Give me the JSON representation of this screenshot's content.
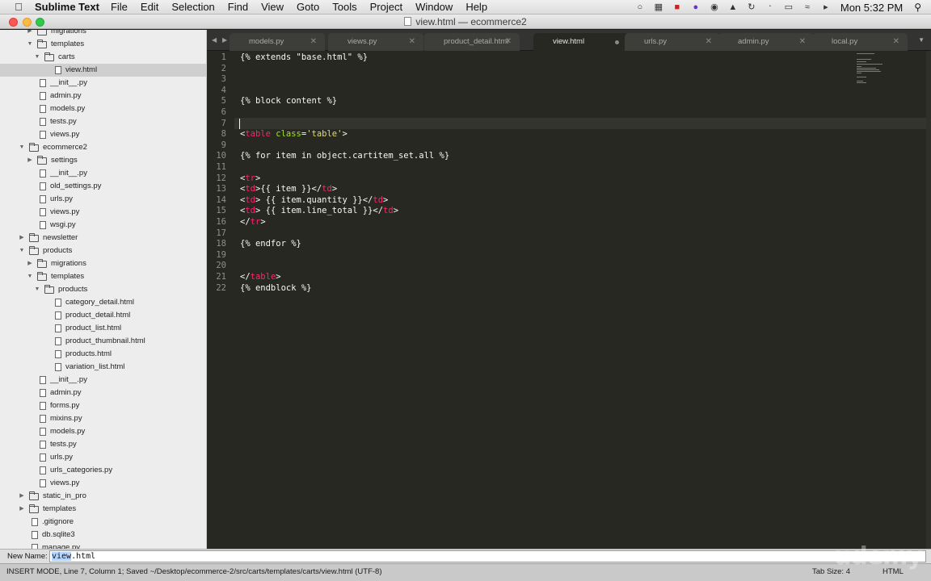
{
  "menubar": {
    "app_name": "Sublime Text",
    "items": [
      "File",
      "Edit",
      "Selection",
      "Find",
      "View",
      "Goto",
      "Tools",
      "Project",
      "Window",
      "Help"
    ],
    "clock": "Mon 5:32 PM",
    "status_icons": [
      "dropbox-icon",
      "menu-tool-icon",
      "evernote-icon",
      "cloud-app-icon",
      "privacy-icon",
      "notification-icon",
      "time-machine-icon",
      "bluetooth-icon",
      "battery-icon",
      "wifi-icon",
      "volume-icon"
    ]
  },
  "window": {
    "title": "view.html — ecommerce2"
  },
  "sidebar": {
    "rows": [
      {
        "name": "migrations",
        "type": "folder",
        "depth": 2,
        "expanded": false
      },
      {
        "name": "templates",
        "type": "folder",
        "depth": 2,
        "expanded": true
      },
      {
        "name": "carts",
        "type": "folder",
        "depth": 3,
        "expanded": true
      },
      {
        "name": "view.html",
        "type": "file",
        "depth": 4,
        "selected": true
      },
      {
        "name": "__init__.py",
        "type": "file",
        "depth": 2
      },
      {
        "name": "admin.py",
        "type": "file",
        "depth": 2
      },
      {
        "name": "models.py",
        "type": "file",
        "depth": 2
      },
      {
        "name": "tests.py",
        "type": "file",
        "depth": 2
      },
      {
        "name": "views.py",
        "type": "file",
        "depth": 2
      },
      {
        "name": "ecommerce2",
        "type": "folder",
        "depth": 1,
        "expanded": true
      },
      {
        "name": "settings",
        "type": "folder",
        "depth": 2,
        "expanded": false
      },
      {
        "name": "__init__.py",
        "type": "file",
        "depth": 2
      },
      {
        "name": "old_settings.py",
        "type": "file",
        "depth": 2
      },
      {
        "name": "urls.py",
        "type": "file",
        "depth": 2
      },
      {
        "name": "views.py",
        "type": "file",
        "depth": 2
      },
      {
        "name": "wsgi.py",
        "type": "file",
        "depth": 2
      },
      {
        "name": "newsletter",
        "type": "folder",
        "depth": 1,
        "expanded": false
      },
      {
        "name": "products",
        "type": "folder",
        "depth": 1,
        "expanded": true
      },
      {
        "name": "migrations",
        "type": "folder",
        "depth": 2,
        "expanded": false
      },
      {
        "name": "templates",
        "type": "folder",
        "depth": 2,
        "expanded": true
      },
      {
        "name": "products",
        "type": "folder",
        "depth": 3,
        "expanded": true
      },
      {
        "name": "category_detail.html",
        "type": "file",
        "depth": 4
      },
      {
        "name": "product_detail.html",
        "type": "file",
        "depth": 4
      },
      {
        "name": "product_list.html",
        "type": "file",
        "depth": 4
      },
      {
        "name": "product_thumbnail.html",
        "type": "file",
        "depth": 4
      },
      {
        "name": "products.html",
        "type": "file",
        "depth": 4
      },
      {
        "name": "variation_list.html",
        "type": "file",
        "depth": 4
      },
      {
        "name": "__init__.py",
        "type": "file",
        "depth": 2
      },
      {
        "name": "admin.py",
        "type": "file",
        "depth": 2
      },
      {
        "name": "forms.py",
        "type": "file",
        "depth": 2
      },
      {
        "name": "mixins.py",
        "type": "file",
        "depth": 2
      },
      {
        "name": "models.py",
        "type": "file",
        "depth": 2
      },
      {
        "name": "tests.py",
        "type": "file",
        "depth": 2
      },
      {
        "name": "urls.py",
        "type": "file",
        "depth": 2
      },
      {
        "name": "urls_categories.py",
        "type": "file",
        "depth": 2
      },
      {
        "name": "views.py",
        "type": "file",
        "depth": 2
      },
      {
        "name": "static_in_pro",
        "type": "folder",
        "depth": 1,
        "expanded": false
      },
      {
        "name": "templates",
        "type": "folder",
        "depth": 1,
        "expanded": false
      },
      {
        "name": ".gitignore",
        "type": "file",
        "depth": 1
      },
      {
        "name": "db.sqlite3",
        "type": "file",
        "depth": 1
      },
      {
        "name": "manage.py",
        "type": "file",
        "depth": 1
      }
    ]
  },
  "tabs": [
    {
      "label": "models.py",
      "active": false,
      "dirty": false
    },
    {
      "label": "views.py",
      "active": false,
      "dirty": false
    },
    {
      "label": "product_detail.html",
      "active": false,
      "dirty": false
    },
    {
      "label": "view.html",
      "active": true,
      "dirty": true
    },
    {
      "label": "urls.py",
      "active": false,
      "dirty": false
    },
    {
      "label": "admin.py",
      "active": false,
      "dirty": false
    },
    {
      "label": "local.py",
      "active": false,
      "dirty": false
    }
  ],
  "editor": {
    "lines": [
      [
        {
          "t": "{% extends \"base.html\" %}"
        }
      ],
      [],
      [],
      [],
      [
        {
          "t": "{% block content %}"
        }
      ],
      [],
      [],
      [
        {
          "t": "<"
        },
        {
          "t": "table",
          "c": "tag"
        },
        {
          "t": " "
        },
        {
          "t": "class",
          "c": "attr"
        },
        {
          "t": "="
        },
        {
          "t": "'table'",
          "c": "str"
        },
        {
          "t": ">"
        }
      ],
      [],
      [
        {
          "t": "{% for item in object.cartitem_set.all %}"
        }
      ],
      [],
      [
        {
          "t": "<"
        },
        {
          "t": "tr",
          "c": "tag"
        },
        {
          "t": ">"
        }
      ],
      [
        {
          "t": "<"
        },
        {
          "t": "td",
          "c": "tag"
        },
        {
          "t": ">{{ item }}</"
        },
        {
          "t": "td",
          "c": "tag"
        },
        {
          "t": ">"
        }
      ],
      [
        {
          "t": "<"
        },
        {
          "t": "td",
          "c": "tag"
        },
        {
          "t": "> {{ item.quantity }}</"
        },
        {
          "t": "td",
          "c": "tag"
        },
        {
          "t": ">"
        }
      ],
      [
        {
          "t": "<"
        },
        {
          "t": "td",
          "c": "tag"
        },
        {
          "t": "> {{ item.line_total }}</"
        },
        {
          "t": "td",
          "c": "tag"
        },
        {
          "t": ">"
        }
      ],
      [
        {
          "t": "</"
        },
        {
          "t": "tr",
          "c": "tag"
        },
        {
          "t": ">"
        }
      ],
      [],
      [
        {
          "t": "{% endfor %}"
        }
      ],
      [],
      [],
      [
        {
          "t": "</"
        },
        {
          "t": "table",
          "c": "tag"
        },
        {
          "t": ">"
        }
      ],
      [
        {
          "t": "{% endblock %}"
        }
      ]
    ],
    "current_line": 7
  },
  "input_panel": {
    "label": "New Name:",
    "selected_part": "view",
    "rest": ".html"
  },
  "statusbar": {
    "message": "INSERT MODE, Line 7, Column 1; Saved ~/Desktop/ecommerce-2/src/carts/templates/carts/view.html (UTF-8)",
    "tab_size": "Tab Size: 4",
    "syntax": "HTML"
  },
  "watermark": "udemy",
  "colors": {
    "editor_bg": "#272822",
    "tag": "#f92672",
    "attr": "#a6e22e",
    "string": "#e6db74",
    "text": "#f8f8f2"
  }
}
